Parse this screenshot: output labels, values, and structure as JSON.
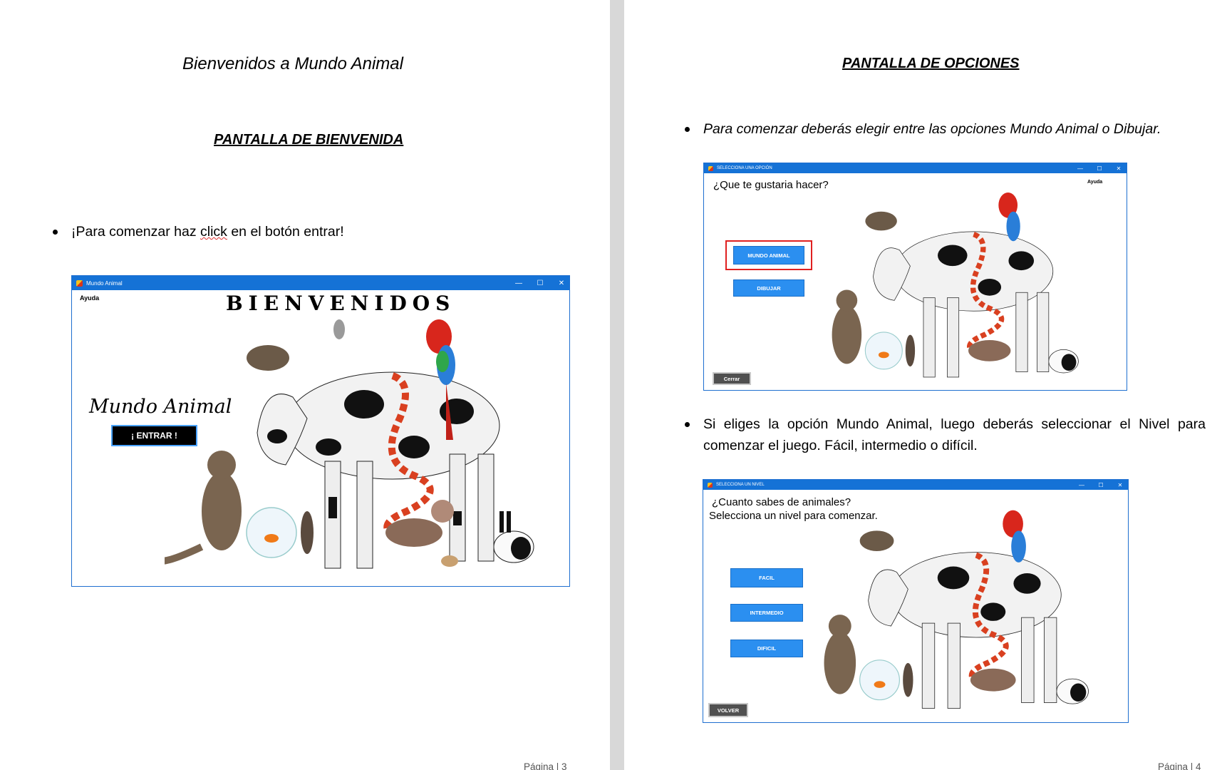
{
  "page_left": {
    "title": "Bienvenidos a Mundo Animal",
    "section_heading": "PANTALLA DE BIENVENIDA",
    "bullet": {
      "before": "¡Para comenzar haz ",
      "squiggle_word": "click",
      "after": " en el botón entrar!"
    },
    "window": {
      "title": "Mundo Animal",
      "menu": "Ayuda",
      "banner": "BIENVENIDOS",
      "logo_text": "Mundo Animal",
      "enter_button": "¡ ENTRAR !"
    },
    "footer": "Página | 3"
  },
  "page_right": {
    "section_heading": "PANTALLA DE OPCIONES",
    "bullet1": "Para comenzar deberás elegir entre las opciones Mundo Animal o Dibujar.",
    "window1": {
      "title": "SELECCIONA UNA OPCIÓN",
      "question": "¿Que te gustaria hacer?",
      "menu": "Ayuda",
      "btn_mundo": "MUNDO ANIMAL",
      "btn_dibujar": "DIBUJAR",
      "btn_cerrar": "Cerrar"
    },
    "bullet2": "Si eliges la opción Mundo Animal, luego deberás seleccionar el Nivel para comenzar el juego. Fácil, intermedio o difícil.",
    "window2": {
      "title": "SELECCIONA UN NIVEL",
      "question_line1": "¿Cuanto sabes de animales?",
      "question_line2": "Selecciona un nivel para comenzar.",
      "btn_facil": "FACIL",
      "btn_intermedio": "INTERMEDIO",
      "btn_dificil": "DIFICIL",
      "btn_volver": "VOLVER"
    },
    "footer": "Página | 4"
  },
  "window_controls": {
    "minimize": "—",
    "maximize": "☐",
    "close": "✕"
  }
}
